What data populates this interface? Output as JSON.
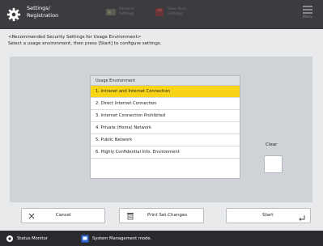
{
  "topbar": {
    "title_line1": "Settings/",
    "title_line2": "Registration",
    "btn2_line1": "Personal",
    "btn2_line2": "Settings",
    "btn3_line1": "Save Pers.",
    "btn3_line2": "Settings",
    "menu_label": "Menu"
  },
  "header": {
    "line1": "<Recommended Security Settings for Usage Environment>",
    "line2": "Select a usage environment, then press [Start] to configure settings."
  },
  "list": {
    "header": "Usage Environment",
    "items": [
      "1. Intranet and Internet Connection",
      "2. Direct Internet Connection",
      "3. Internet Connection Prohibited",
      "4. Private (Home) Network",
      "5. Public Network",
      "6. Highly Confidential Info. Environment"
    ],
    "selected_index": 0
  },
  "clear": {
    "label": "Clear"
  },
  "buttons": {
    "cancel": "Cancel",
    "print": "Print Set.Changes",
    "start": "Start"
  },
  "statusbar": {
    "status_monitor": "Status Monitor",
    "system_mode": "System Management mode."
  },
  "colors": {
    "topbar": "#3c3c40",
    "selected": "#f7d516",
    "panel": "#cfd2d6",
    "statusbar": "#2a2a2e"
  }
}
